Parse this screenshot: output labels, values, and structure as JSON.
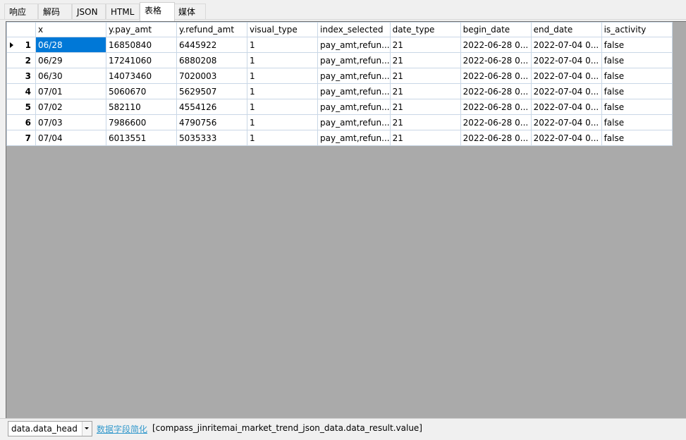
{
  "tabs": [
    {
      "label": "响应"
    },
    {
      "label": "解码"
    },
    {
      "label": "JSON"
    },
    {
      "label": "HTML"
    },
    {
      "label": "表格"
    },
    {
      "label": "媒体"
    }
  ],
  "active_tab": "表格",
  "grid": {
    "columns": [
      "x",
      "y.pay_amt",
      "y.refund_amt",
      "visual_type",
      "index_selected",
      "date_type",
      "begin_date",
      "end_date",
      "is_activity"
    ],
    "rows": [
      {
        "num": "1",
        "cells": [
          "06/28",
          "16850840",
          "6445922",
          "1",
          "pay_amt,refun...",
          "21",
          "2022-06-28 0...",
          "2022-07-04 0...",
          "false"
        ]
      },
      {
        "num": "2",
        "cells": [
          "06/29",
          "17241060",
          "6880208",
          "1",
          "pay_amt,refun...",
          "21",
          "2022-06-28 0...",
          "2022-07-04 0...",
          "false"
        ]
      },
      {
        "num": "3",
        "cells": [
          "06/30",
          "14073460",
          "7020003",
          "1",
          "pay_amt,refun...",
          "21",
          "2022-06-28 0...",
          "2022-07-04 0...",
          "false"
        ]
      },
      {
        "num": "4",
        "cells": [
          "07/01",
          "5060670",
          "5629507",
          "1",
          "pay_amt,refun...",
          "21",
          "2022-06-28 0...",
          "2022-07-04 0...",
          "false"
        ]
      },
      {
        "num": "5",
        "cells": [
          "07/02",
          "582110",
          "4554126",
          "1",
          "pay_amt,refun...",
          "21",
          "2022-06-28 0...",
          "2022-07-04 0...",
          "false"
        ]
      },
      {
        "num": "6",
        "cells": [
          "07/03",
          "7986600",
          "4790756",
          "1",
          "pay_amt,refun...",
          "21",
          "2022-06-28 0...",
          "2022-07-04 0...",
          "false"
        ]
      },
      {
        "num": "7",
        "cells": [
          "07/04",
          "6013551",
          "5035333",
          "1",
          "pay_amt,refun...",
          "21",
          "2022-06-28 0...",
          "2022-07-04 0...",
          "false"
        ]
      }
    ],
    "selected_cell": {
      "row": 0,
      "col": 0
    }
  },
  "bottom": {
    "combo_value": "data.data_head",
    "link_label": "数据字段简化",
    "path": "[compass_jinritemai_market_trend_json_data.data_result.value]"
  },
  "colors": {
    "selection": "#0078d7",
    "grid_bg": "#aaaaaa",
    "link": "#3399cc"
  }
}
